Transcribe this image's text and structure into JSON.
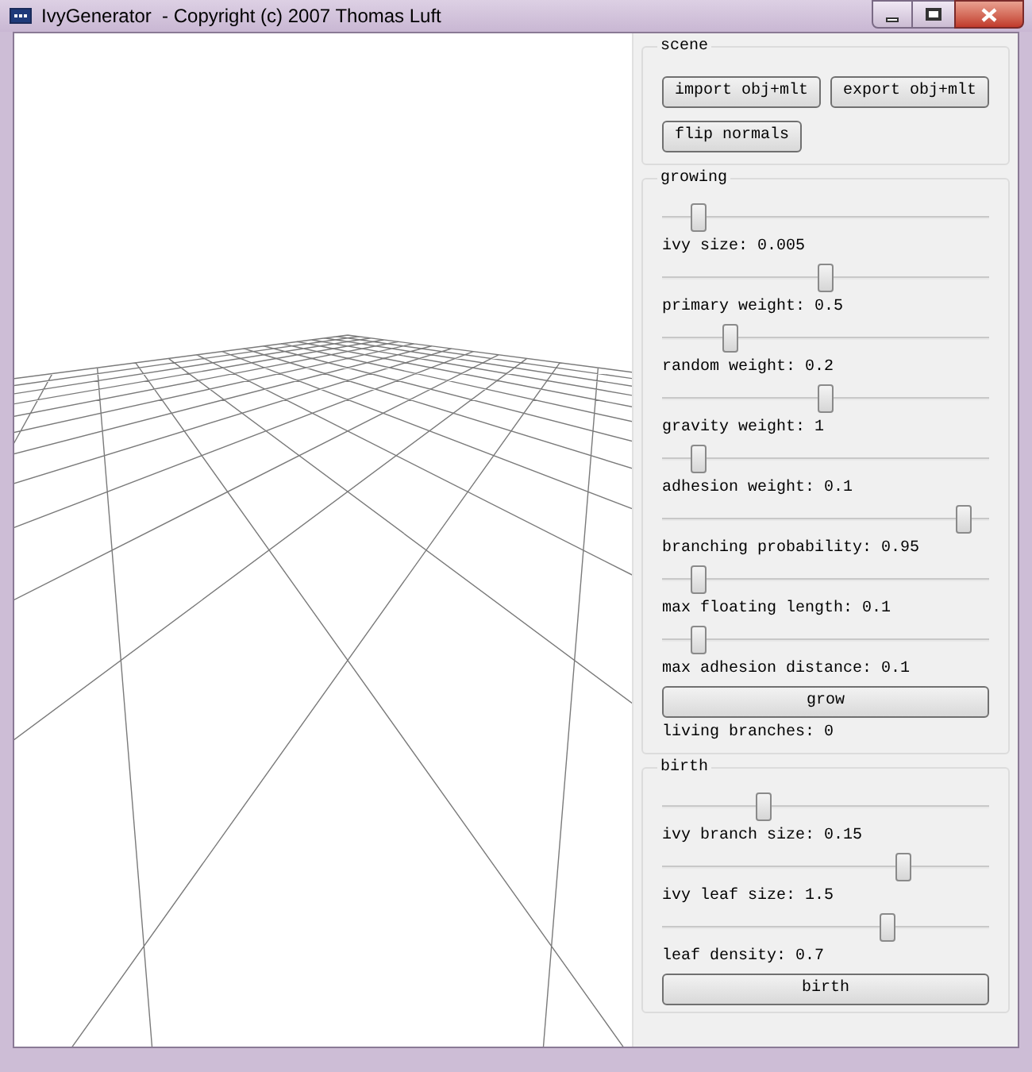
{
  "window": {
    "title": "IvyGenerator  - Copyright (c) 2007 Thomas Luft"
  },
  "groups": [
    {
      "title": "scene",
      "items": [
        {
          "kind": "buttonrow",
          "buttons": [
            "import obj+mlt",
            "export obj+mlt"
          ]
        },
        {
          "kind": "buttonrow",
          "buttons": [
            "flip normals"
          ]
        }
      ]
    },
    {
      "title": "growing",
      "items": [
        {
          "kind": "slider",
          "level": 0.11
        },
        {
          "kind": "label",
          "text": "ivy size: 0.005"
        },
        {
          "kind": "slider",
          "level": 0.5
        },
        {
          "kind": "label",
          "text": "primary weight: 0.5"
        },
        {
          "kind": "slider",
          "level": 0.21
        },
        {
          "kind": "label",
          "text": "random weight: 0.2"
        },
        {
          "kind": "slider",
          "level": 0.5
        },
        {
          "kind": "label",
          "text": "gravity weight: 1"
        },
        {
          "kind": "slider",
          "level": 0.11
        },
        {
          "kind": "label",
          "text": "adhesion weight: 0.1"
        },
        {
          "kind": "slider",
          "level": 0.92
        },
        {
          "kind": "label",
          "text": "branching probability: 0.95"
        },
        {
          "kind": "slider",
          "level": 0.11
        },
        {
          "kind": "label",
          "text": "max floating length: 0.1"
        },
        {
          "kind": "slider",
          "level": 0.11
        },
        {
          "kind": "label",
          "text": "max adhesion distance: 0.1"
        },
        {
          "kind": "button",
          "label": "grow"
        },
        {
          "kind": "label",
          "text": "living branches: 0"
        }
      ]
    },
    {
      "title": "birth",
      "items": [
        {
          "kind": "slider",
          "level": 0.31
        },
        {
          "kind": "label",
          "text": "ivy branch size: 0.15"
        },
        {
          "kind": "slider",
          "level": 0.74
        },
        {
          "kind": "label",
          "text": "ivy leaf size: 1.5"
        },
        {
          "kind": "slider",
          "level": 0.69
        },
        {
          "kind": "label",
          "text": "leaf density: 0.7"
        },
        {
          "kind": "button",
          "label": "birth"
        }
      ]
    }
  ]
}
